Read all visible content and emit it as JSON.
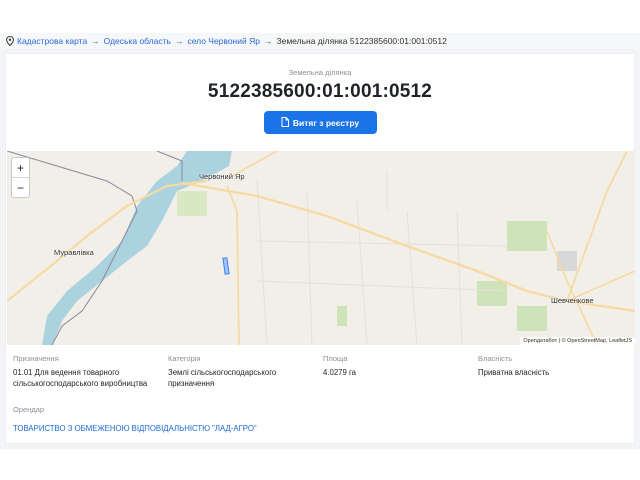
{
  "breadcrumb": {
    "items": [
      "Кадастрова карта",
      "Одеська область",
      "село Червоний Яр"
    ],
    "separator": "→",
    "current": "Земельна ділянка 5122385600:01:001:0512"
  },
  "header": {
    "subtitle": "Земельна ділянка",
    "parcel_number": "5122385600:01:001:0512",
    "extract_button": "Витяг з реєстру"
  },
  "map": {
    "zoom_in": "+",
    "zoom_out": "−",
    "places": [
      "Червоний Яр",
      "Муравлівка",
      "Шевченкове"
    ],
    "attribution": "Openдатабот | © OpenStreetMap, LeafletJS"
  },
  "details": {
    "purpose_label": "Призначення",
    "purpose_value": "01.01 Для ведення товарного сільськогосподарського виробництва",
    "category_label": "Категорія",
    "category_value": "Землі сільськогосподарського призначення",
    "area_label": "Площа",
    "area_value": "4.0279 га",
    "ownership_label": "Власність",
    "ownership_value": "Приватна власність",
    "tenant_label": "Орендар",
    "tenant_value": "ТОВАРИСТВО З ОБМЕЖЕНОЮ ВІДПОВІДАЛЬНІСТЮ \"ЛАД-АГРО\""
  },
  "colors": {
    "accent": "#1b73e8",
    "link": "#2a6ad8",
    "water": "#aad3df",
    "road": "#f6d9a3",
    "parcel": "#3b82f6"
  }
}
